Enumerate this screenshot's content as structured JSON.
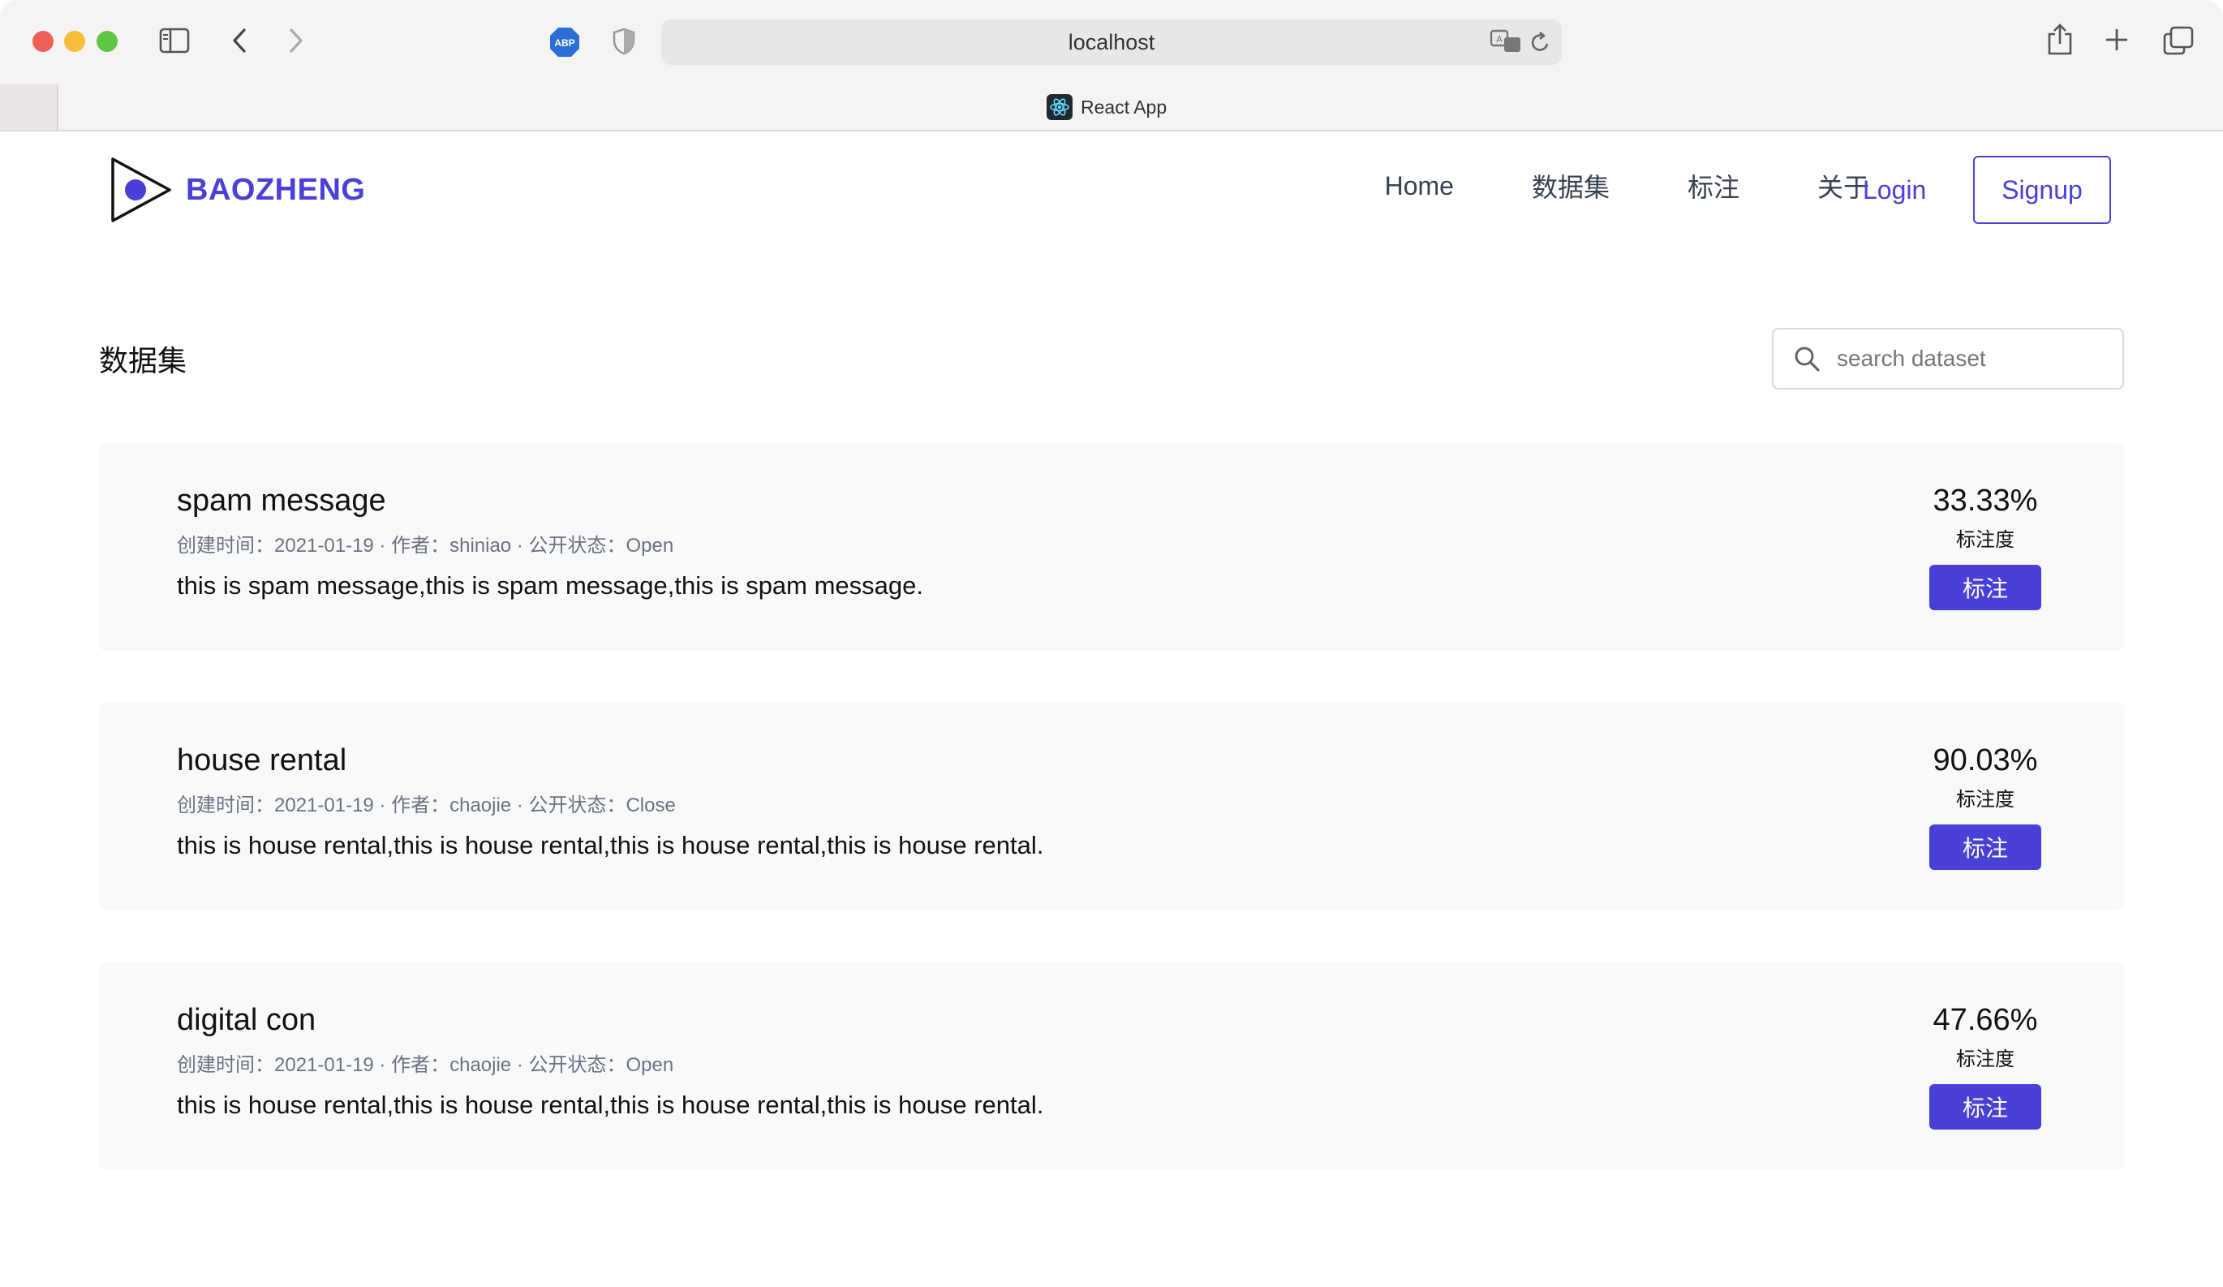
{
  "browser": {
    "url": "localhost",
    "tab_title": "React App",
    "icons": [
      "sidebar-icon",
      "back-icon",
      "forward-icon",
      "adblock-icon",
      "shield-icon",
      "translate-icon",
      "reload-icon",
      "share-icon",
      "new-tab-icon",
      "tabs-overview-icon"
    ]
  },
  "nav": {
    "brand": "BAOZHENG",
    "links": [
      "Home",
      "数据集",
      "标注",
      "关于"
    ],
    "login": "Login",
    "signup": "Signup"
  },
  "page": {
    "title": "数据集",
    "search_placeholder": "search dataset"
  },
  "datasets": [
    {
      "name": "spam message",
      "meta": "创建时间：2021-01-19 · 作者：shiniao · 公开状态：Open",
      "description": "this is spam message,this is spam message,this is spam message.",
      "progress": "33.33%",
      "progress_label": "标注度",
      "action": "标注"
    },
    {
      "name": "house rental",
      "meta": "创建时间：2021-01-19 · 作者：chaojie · 公开状态：Close",
      "description": "this is house rental,this is house rental,this is house rental,this is house rental.",
      "progress": "90.03%",
      "progress_label": "标注度",
      "action": "标注"
    },
    {
      "name": "digital con",
      "meta": "创建时间：2021-01-19 · 作者：chaojie · 公开状态：Open",
      "description": "this is house rental,this is house rental,this is house rental,this is house rental.",
      "progress": "47.66%",
      "progress_label": "标注度",
      "action": "标注"
    }
  ],
  "colors": {
    "accent": "#4a3fd6",
    "card_bg": "#f8f9fb",
    "chrome_bg": "#f6f3f4"
  }
}
